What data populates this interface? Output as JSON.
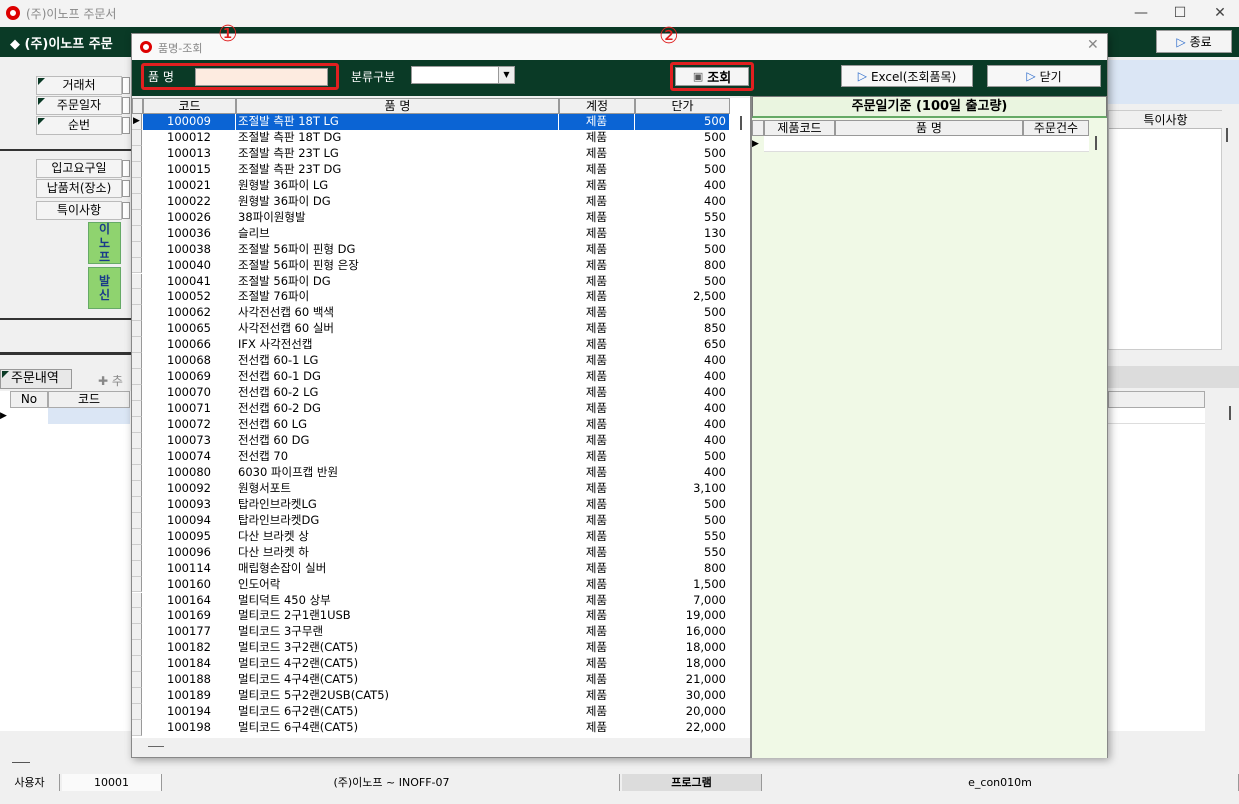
{
  "window": {
    "title": "(주)이노프 주문서",
    "header_title": "◆ (주)이노프 주문",
    "exit_label": "종료"
  },
  "form": {
    "labels": {
      "customer": "거래처",
      "order_date": "주문일자",
      "seq": "순번",
      "request_date": "입고요구일",
      "delivery": "납품처(장소)",
      "remarks": "특이사항"
    },
    "green_buttons": {
      "inof": "이노프",
      "send": "발신"
    },
    "right_header": "특이사항"
  },
  "order": {
    "tab_label": "주문내역",
    "add_label": "추",
    "columns": {
      "no": "No",
      "code": "코드"
    }
  },
  "statusbar": {
    "user_label": "사용자",
    "user_id": "10001",
    "company": "(주)이노프 ~ INOFF-07",
    "program_label": "프로그램",
    "program_id": "e_con010m"
  },
  "dialog": {
    "title": "품명-조회",
    "name_label": "품 명",
    "name_value": "",
    "category_label": "분류구분",
    "category_value": "",
    "search_label": "조회",
    "excel_label": "Excel(조회품목)",
    "close_label": "닫기",
    "markers": {
      "one": "①",
      "two": "②"
    },
    "columns": {
      "code": "코드",
      "name": "품 명",
      "account": "계정",
      "price": "단가"
    },
    "items": [
      {
        "code": "100009",
        "name": "조절발 측판 18T LG",
        "account": "제품",
        "price": "500"
      },
      {
        "code": "100012",
        "name": "조절발 측판 18T DG",
        "account": "제품",
        "price": "500"
      },
      {
        "code": "100013",
        "name": "조절발 측판 23T LG",
        "account": "제품",
        "price": "500"
      },
      {
        "code": "100015",
        "name": "조절발 측판 23T DG",
        "account": "제품",
        "price": "500"
      },
      {
        "code": "100021",
        "name": "원형발 36파이 LG",
        "account": "제품",
        "price": "400"
      },
      {
        "code": "100022",
        "name": "원형발 36파이 DG",
        "account": "제품",
        "price": "400"
      },
      {
        "code": "100026",
        "name": "38파이원형발",
        "account": "제품",
        "price": "550"
      },
      {
        "code": "100036",
        "name": "슬리브",
        "account": "제품",
        "price": "130"
      },
      {
        "code": "100038",
        "name": "조절발 56파이 핀형 DG",
        "account": "제품",
        "price": "500"
      },
      {
        "code": "100040",
        "name": "조절발 56파이 핀형 은장",
        "account": "제품",
        "price": "800"
      },
      {
        "code": "100041",
        "name": "조절발 56파이 DG",
        "account": "제품",
        "price": "500"
      },
      {
        "code": "100052",
        "name": "조절발 76파이",
        "account": "제품",
        "price": "2,500"
      },
      {
        "code": "100062",
        "name": "사각전선캡 60 백색",
        "account": "제품",
        "price": "500"
      },
      {
        "code": "100065",
        "name": "사각전선캡 60 실버",
        "account": "제품",
        "price": "850"
      },
      {
        "code": "100066",
        "name": "IFX 사각전선캡",
        "account": "제품",
        "price": "650"
      },
      {
        "code": "100068",
        "name": "전선캡 60-1 LG",
        "account": "제품",
        "price": "400"
      },
      {
        "code": "100069",
        "name": "전선캡 60-1 DG",
        "account": "제품",
        "price": "400"
      },
      {
        "code": "100070",
        "name": "전선캡 60-2 LG",
        "account": "제품",
        "price": "400"
      },
      {
        "code": "100071",
        "name": "전선캡 60-2 DG",
        "account": "제품",
        "price": "400"
      },
      {
        "code": "100072",
        "name": "전선캡 60 LG",
        "account": "제품",
        "price": "400"
      },
      {
        "code": "100073",
        "name": "전선캡 60 DG",
        "account": "제품",
        "price": "400"
      },
      {
        "code": "100074",
        "name": "전선캡 70",
        "account": "제품",
        "price": "500"
      },
      {
        "code": "100080",
        "name": "6030 파이프캡 반원",
        "account": "제품",
        "price": "400"
      },
      {
        "code": "100092",
        "name": "원형서포트",
        "account": "제품",
        "price": "3,100"
      },
      {
        "code": "100093",
        "name": "탑라인브라켓LG",
        "account": "제품",
        "price": "500"
      },
      {
        "code": "100094",
        "name": "탑라인브라켓DG",
        "account": "제품",
        "price": "500"
      },
      {
        "code": "100095",
        "name": "다산 브라켓 상",
        "account": "제품",
        "price": "550"
      },
      {
        "code": "100096",
        "name": "다산 브라켓 하",
        "account": "제품",
        "price": "550"
      },
      {
        "code": "100114",
        "name": "매립형손잡이 실버",
        "account": "제품",
        "price": "800"
      },
      {
        "code": "100160",
        "name": "인도어락",
        "account": "제품",
        "price": "1,500"
      },
      {
        "code": "100164",
        "name": "멀티덕트 450 상부",
        "account": "제품",
        "price": "7,000"
      },
      {
        "code": "100169",
        "name": "멀티코드 2구1랜1USB",
        "account": "제품",
        "price": "19,000"
      },
      {
        "code": "100177",
        "name": "멀티코드 3구무랜",
        "account": "제품",
        "price": "16,000"
      },
      {
        "code": "100182",
        "name": "멀티코드 3구2랜(CAT5)",
        "account": "제품",
        "price": "18,000"
      },
      {
        "code": "100184",
        "name": "멀티코드 4구2랜(CAT5)",
        "account": "제품",
        "price": "18,000"
      },
      {
        "code": "100188",
        "name": "멀티코드 4구4랜(CAT5)",
        "account": "제품",
        "price": "21,000"
      },
      {
        "code": "100189",
        "name": "멀티코드 5구2랜2USB(CAT5)",
        "account": "제품",
        "price": "30,000"
      },
      {
        "code": "100194",
        "name": "멀티코드 6구2랜(CAT5)",
        "account": "제품",
        "price": "20,000"
      },
      {
        "code": "100198",
        "name": "멀티코드 6구4랜(CAT5)",
        "account": "제품",
        "price": "22,000"
      }
    ],
    "stock": {
      "header": "주문일기준 (100일 출고량)",
      "columns": {
        "code": "제품코드",
        "name": "품 명",
        "count": "주문건수"
      }
    }
  },
  "colors": {
    "accent_green": "#0a3a26",
    "highlight_red": "#e02020",
    "selection_blue": "#0b64d4"
  }
}
